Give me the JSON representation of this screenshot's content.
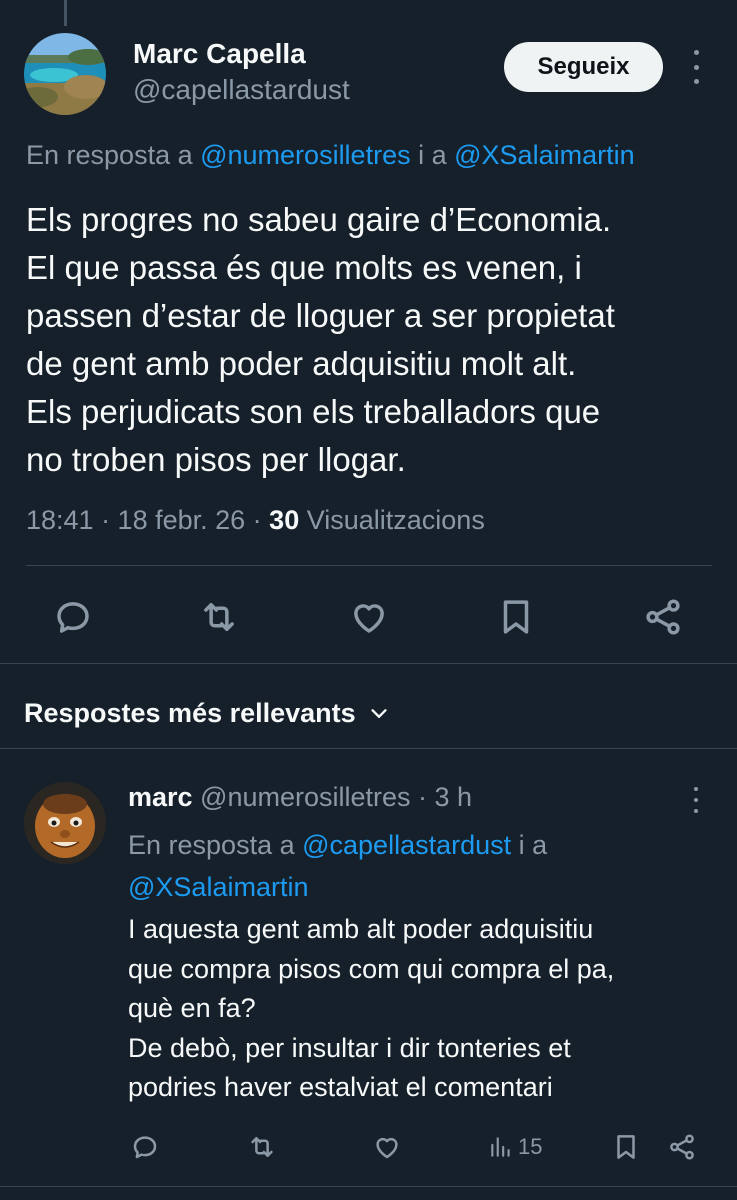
{
  "main_tweet": {
    "author_name": "Marc Capella",
    "author_handle": "@capellastardust",
    "follow_label": "Segueix",
    "reply_prefix": "En resposta a ",
    "reply_mention_1": "@numerosilletres",
    "reply_joiner": " i a ",
    "reply_mention_2": "@XSalaimartin",
    "text_lines": [
      "Els progres no sabeu gaire d’Economia.",
      "El que passa és que molts es venen, i",
      "passen d’estar de lloguer a ser propietat",
      "de gent amb poder adquisitiu molt alt.",
      "Els perjudicats son els treballadors que",
      "no troben pisos per llogar."
    ],
    "time_date": "18:41 · 18 febr. 26 · ",
    "views_count": "30",
    "views_label": " Visualitzacions",
    "actions": [
      "reply-icon",
      "retweet-icon",
      "like-icon",
      "bookmark-icon",
      "share-icon"
    ]
  },
  "replies_section": {
    "title": "Respostes més rellevants"
  },
  "reply": {
    "author_name": "marc",
    "author_handle": " @numerosilletres · 3 h",
    "reply_prefix": "En resposta a ",
    "reply_mention_1": "@capellastardust",
    "reply_joiner": " i a",
    "reply_mention_2": "@XSalaimartin",
    "text_lines": [
      "I aquesta gent amb alt poder adquisitiu",
      "que compra pisos com qui compra el pa,",
      "què en fa?",
      "De debò, per insultar i dir tonteries et",
      "podries haver estalviat el comentari"
    ],
    "views": "15"
  },
  "colors": {
    "background": "#15202b",
    "accent": "#1d9bf0",
    "muted": "#8b98a5",
    "divider": "#38444d"
  }
}
